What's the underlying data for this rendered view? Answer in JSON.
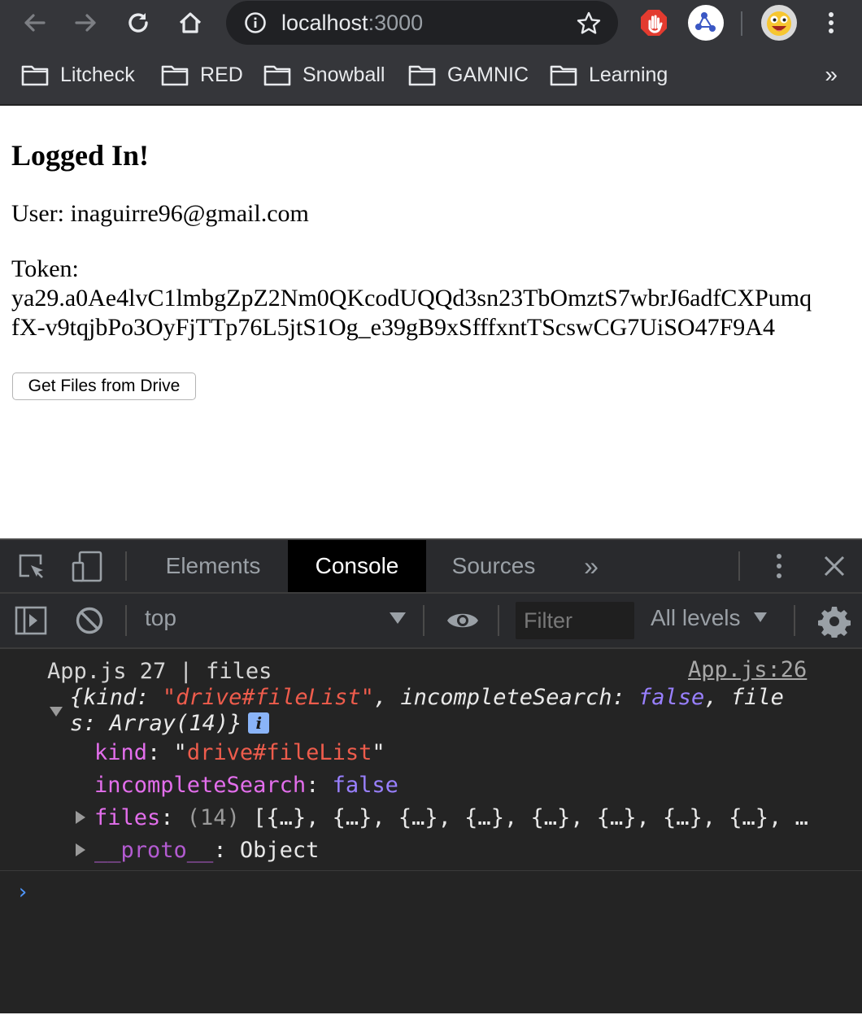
{
  "browser": {
    "address": {
      "host": "localhost",
      "port": ":3000"
    },
    "bookmarks": [
      {
        "label": "Litcheck"
      },
      {
        "label": "RED"
      },
      {
        "label": "Snowball"
      },
      {
        "label": "GAMNIC"
      },
      {
        "label": "Learning"
      }
    ],
    "bookmarks_more": "»",
    "icons": [
      "back-icon",
      "forward-icon",
      "reload-icon",
      "home-icon",
      "info-icon",
      "star-icon",
      "adblock-icon",
      "extension-icon",
      "avatar",
      "menu-icon"
    ]
  },
  "page": {
    "heading": "Logged In!",
    "user_line": "User: inaguirre96@gmail.com",
    "token_label": "Token:",
    "token_line1": "ya29.a0Ae4lvC1lmbgZpZ2Nm0QKcodUQQd3sn23TbOmztS7wbrJ6adfCXPumq",
    "token_line2": "fX-v9tqjbPo3OyFjTTp76L5jtS1Og_e39gB9xSfffxntTScswCG7UiSO47F9A4",
    "button": "Get Files from Drive"
  },
  "devtools": {
    "tabs": [
      {
        "label": "Elements",
        "active": false
      },
      {
        "label": "Console",
        "active": true
      },
      {
        "label": "Sources",
        "active": false
      }
    ],
    "tabs_more": "»",
    "context": "top",
    "filter_placeholder": "Filter",
    "levels": "All levels",
    "console": {
      "log_text": "App.js 27 | files",
      "source": "App.js:26",
      "summary": {
        "open": "{",
        "kind_key": "kind",
        "kind_val": "\"drive#fileList\"",
        "incomplete_key": "incompleteSearch",
        "incomplete_val": "false",
        "files_key_a": "file",
        "files_key_b": "s",
        "files_val": "Array(14)",
        "close": "}"
      },
      "info_badge": "i",
      "props": {
        "kind_key": "kind",
        "kind_val": "drive#fileList",
        "incomplete_key": "incompleteSearch",
        "incomplete_val": "false",
        "files_key": "files",
        "files_count": "(14)",
        "files_preview": "[{…}, {…}, {…}, {…}, {…}, {…}, {…}, {…}, …",
        "proto_key": "__proto__",
        "proto_val": "Object"
      },
      "prompt": "›"
    }
  }
}
